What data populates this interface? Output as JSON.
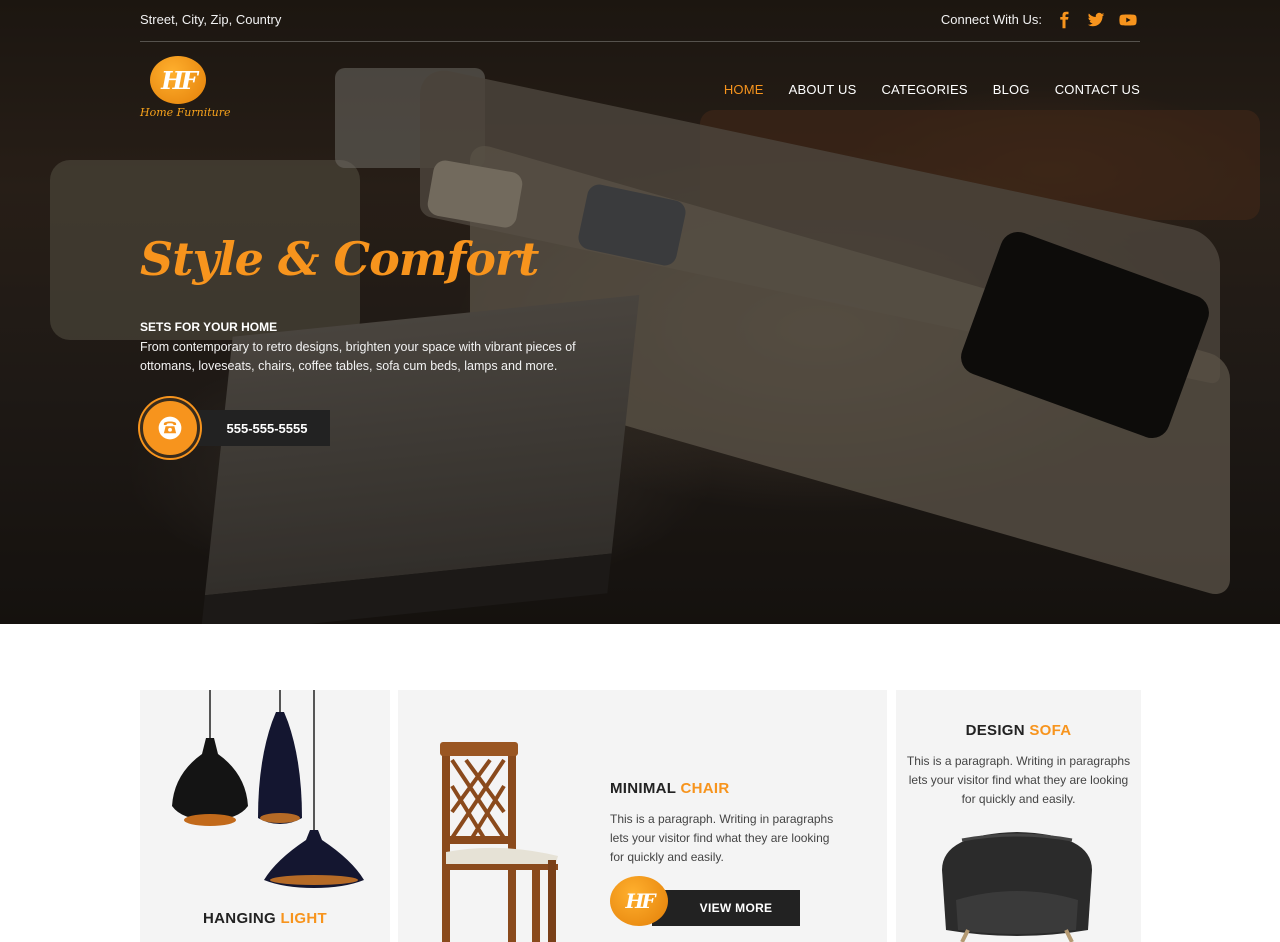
{
  "topbar": {
    "address": "Street, City, Zip, Country",
    "connect_label": "Connect With Us:",
    "social": [
      "facebook-icon",
      "twitter-icon",
      "youtube-icon"
    ]
  },
  "logo": {
    "monogram": "HF",
    "text": "Home Furniture"
  },
  "nav": {
    "items": [
      {
        "label": "HOME",
        "active": true
      },
      {
        "label": "ABOUT US",
        "active": false
      },
      {
        "label": "CATEGORIES",
        "active": false
      },
      {
        "label": "BLOG",
        "active": false
      },
      {
        "label": "CONTACT US",
        "active": false
      }
    ]
  },
  "hero": {
    "title": "Style & Comfort",
    "subtitle": "SETS FOR YOUR HOME",
    "description": "From contemporary to retro designs, brighten your space with vibrant pieces of ottomans, loveseats, chairs, coffee tables, sofa cum beds, lamps and more.",
    "phone": "555-555-5555"
  },
  "products": [
    {
      "title_main": "HANGING",
      "title_accent": "LIGHT"
    },
    {
      "title_main": "MINIMAL",
      "title_accent": "CHAIR",
      "description": "This is a paragraph. Writing in paragraphs lets your visitor find what they are looking for quickly and easily.",
      "button": "VIEW MORE",
      "button_logo": "HF"
    },
    {
      "title_main": "DESIGN",
      "title_accent": "SOFA",
      "description": "This is a paragraph. Writing in paragraphs lets your visitor find what they are looking for quickly and easily."
    }
  ],
  "colors": {
    "accent": "#f7941d",
    "dark": "#222222",
    "card_bg": "#f4f4f4"
  }
}
